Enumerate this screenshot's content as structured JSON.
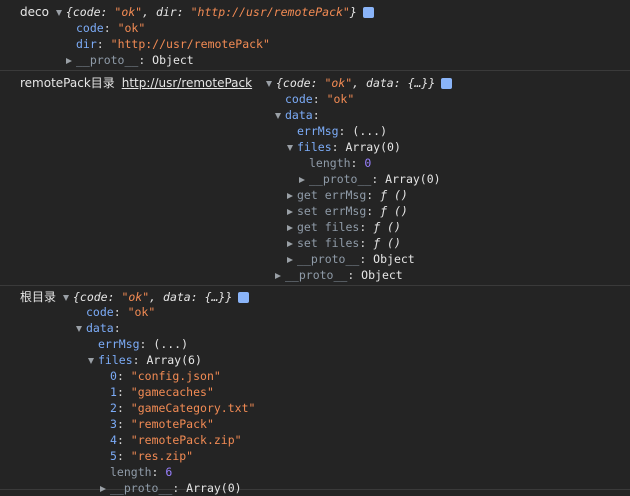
{
  "colors": {
    "background": "#242424",
    "string": "#f28b54",
    "key": "#7cacf8",
    "number": "#9980ff",
    "dim_key": "#8f9ba8",
    "info_icon": "#8ab4f8"
  },
  "entry1": {
    "label": "deco",
    "preview": {
      "open": "{",
      "k_code": "code",
      "v_code": "\"ok\"",
      "k_dir": "dir",
      "v_dir": "\"http://usr/remotePack\"",
      "close": "}"
    },
    "code_key": "code",
    "code_value": "\"ok\"",
    "dir_key": "dir",
    "dir_value": "\"http://usr/remotePack\"",
    "proto_key": "__proto__",
    "proto_value": "Object"
  },
  "entry2": {
    "label": "remotePack目录",
    "link": "http://usr/remotePack",
    "preview": {
      "open": "{",
      "k_code": "code",
      "v_code": "\"ok\"",
      "k_data": "data",
      "v_data": "{…}",
      "close": "}"
    },
    "code_key": "code",
    "code_value": "\"ok\"",
    "data_key": "data",
    "errmsg_key": "errMsg",
    "errmsg_value": "(...)",
    "files_key": "files",
    "files_value": "Array(0)",
    "length_key": "length",
    "length_value": "0",
    "files_proto_key": "__proto__",
    "files_proto_value": "Array(0)",
    "getters": [
      {
        "kind": "get",
        "name": "errMsg",
        "value": "ƒ ()"
      },
      {
        "kind": "set",
        "name": "errMsg",
        "value": "ƒ ()"
      },
      {
        "kind": "get",
        "name": "files",
        "value": "ƒ ()"
      },
      {
        "kind": "set",
        "name": "files",
        "value": "ƒ ()"
      }
    ],
    "data_proto_key": "__proto__",
    "data_proto_value": "Object",
    "proto_key": "__proto__",
    "proto_value": "Object"
  },
  "entry3": {
    "label": "根目录",
    "preview": {
      "open": "{",
      "k_code": "code",
      "v_code": "\"ok\"",
      "k_data": "data",
      "v_data": "{…}",
      "close": "}"
    },
    "code_key": "code",
    "code_value": "\"ok\"",
    "data_key": "data",
    "errmsg_key": "errMsg",
    "errmsg_value": "(...)",
    "files_key": "files",
    "files_value": "Array(6)",
    "items": [
      {
        "index": "0",
        "value": "\"config.json\""
      },
      {
        "index": "1",
        "value": "\"gamecaches\""
      },
      {
        "index": "2",
        "value": "\"gameCategory.txt\""
      },
      {
        "index": "3",
        "value": "\"remotePack\""
      },
      {
        "index": "4",
        "value": "\"remotePack.zip\""
      },
      {
        "index": "5",
        "value": "\"res.zip\""
      }
    ],
    "length_key": "length",
    "length_value": "6",
    "files_proto_key": "__proto__",
    "files_proto_value": "Array(0)"
  }
}
